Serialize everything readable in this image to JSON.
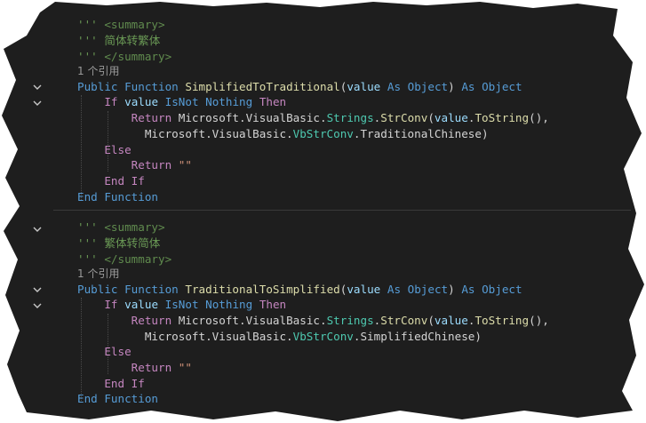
{
  "theme": {
    "background": "#1e1e1e",
    "comment_color": "#6a9955",
    "keyword_color": "#569cd6",
    "control_keyword_color": "#c586c0",
    "type_color": "#4ec9b0",
    "function_color": "#dcdcaa",
    "parameter_color": "#9cdcfe",
    "string_color": "#ce9178",
    "codelens_color": "#9a9a9a"
  },
  "icons": {
    "fold": "chevron-down-icon"
  },
  "functions": [
    {
      "doc": {
        "l1": {
          "prefix": "''' ",
          "tag": "<summary>"
        },
        "l2": {
          "prefix": "''' ",
          "text": "简体转繁体"
        },
        "l3": {
          "prefix": "''' ",
          "tag": "</summary>"
        }
      },
      "codelens": "1 个引用",
      "signature": {
        "kw_public": "Public",
        "kw_function": "Function",
        "name": "SimplifiedToTraditional",
        "open_paren": "(",
        "param": "value",
        "kw_as1": "As",
        "type1": "Object",
        "close_paren": ")",
        "kw_as2": "As",
        "type2": "Object"
      },
      "if_line": {
        "kw_if": "If",
        "ident": "value",
        "kw_isnot": "IsNot",
        "kw_nothing": "Nothing",
        "kw_then": "Then"
      },
      "return_line": {
        "kw_return": "Return",
        "ns": "Microsoft.VisualBasic.",
        "cls": "Strings",
        "dot": ".",
        "func": "StrConv",
        "open": "(",
        "arg": "value",
        "dot2": ".",
        "method": "ToString",
        "tail": "(),"
      },
      "cont_line": {
        "ns": "Microsoft.VisualBasic.",
        "enum": "VbStrConv",
        "member": ".TraditionalChinese)"
      },
      "else_kw": "Else",
      "return2": {
        "kw_return": "Return",
        "str": "\"\""
      },
      "end_if": "End If",
      "end_function": "End Function"
    },
    {
      "doc": {
        "l1": {
          "prefix": "''' ",
          "tag": "<summary>"
        },
        "l2": {
          "prefix": "''' ",
          "text": "繁体转简体"
        },
        "l3": {
          "prefix": "''' ",
          "tag": "</summary>"
        }
      },
      "codelens": "1 个引用",
      "signature": {
        "kw_public": "Public",
        "kw_function": "Function",
        "name": "TraditionalToSimplified",
        "open_paren": "(",
        "param": "value",
        "kw_as1": "As",
        "type1": "Object",
        "close_paren": ")",
        "kw_as2": "As",
        "type2": "Object"
      },
      "if_line": {
        "kw_if": "If",
        "ident": "value",
        "kw_isnot": "IsNot",
        "kw_nothing": "Nothing",
        "kw_then": "Then"
      },
      "return_line": {
        "kw_return": "Return",
        "ns": "Microsoft.VisualBasic.",
        "cls": "Strings",
        "dot": ".",
        "func": "StrConv",
        "open": "(",
        "arg": "value",
        "dot2": ".",
        "method": "ToString",
        "tail": "(),"
      },
      "cont_line": {
        "ns": "Microsoft.VisualBasic.",
        "enum": "VbStrConv",
        "member": ".SimplifiedChinese)"
      },
      "else_kw": "Else",
      "return2": {
        "kw_return": "Return",
        "str": "\"\""
      },
      "end_if": "End If",
      "end_function": "End Function"
    }
  ]
}
